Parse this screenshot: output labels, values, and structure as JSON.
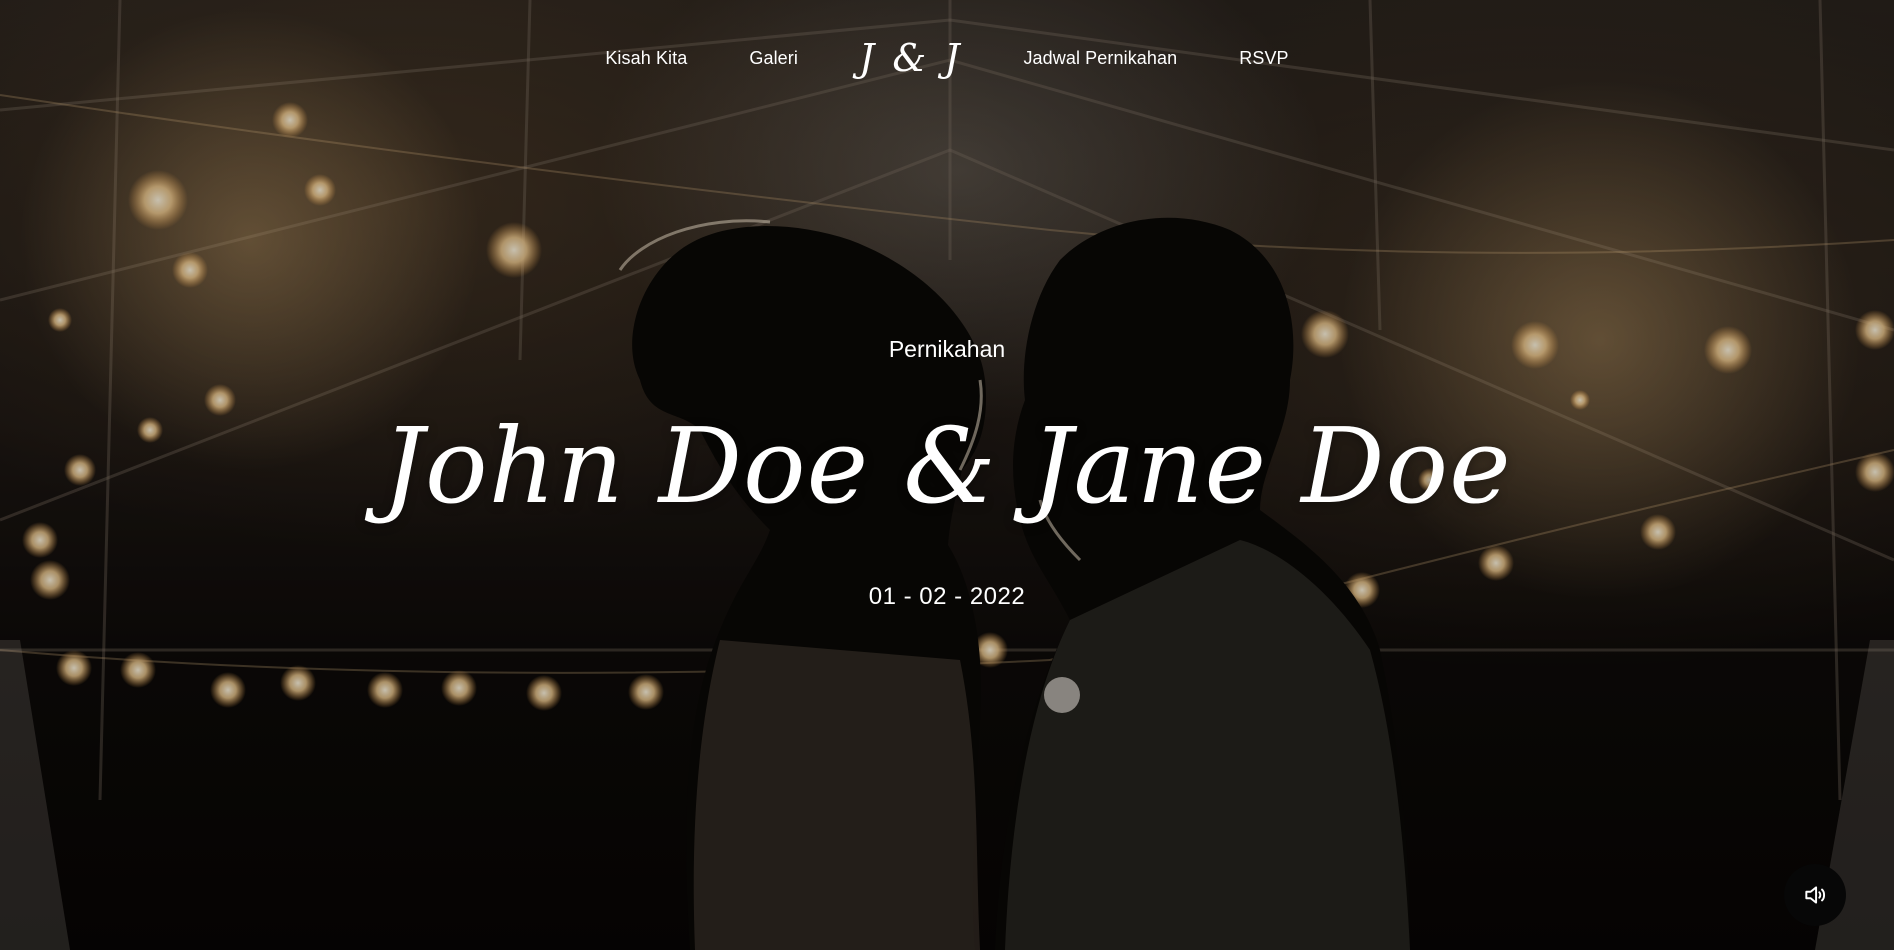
{
  "nav": {
    "items": [
      {
        "label": "Kisah Kita"
      },
      {
        "label": "Galeri"
      },
      {
        "label": "Jadwal Pernikahan"
      },
      {
        "label": "RSVP"
      }
    ],
    "logo": "J & J"
  },
  "hero": {
    "subtitle": "Pernikahan",
    "names": "John Doe & Jane Doe",
    "date": "01 - 02 - 2022"
  },
  "controls": {
    "sound_icon": "speaker-icon"
  },
  "colors": {
    "text": "#ffffff",
    "button_bg": "#070707"
  }
}
